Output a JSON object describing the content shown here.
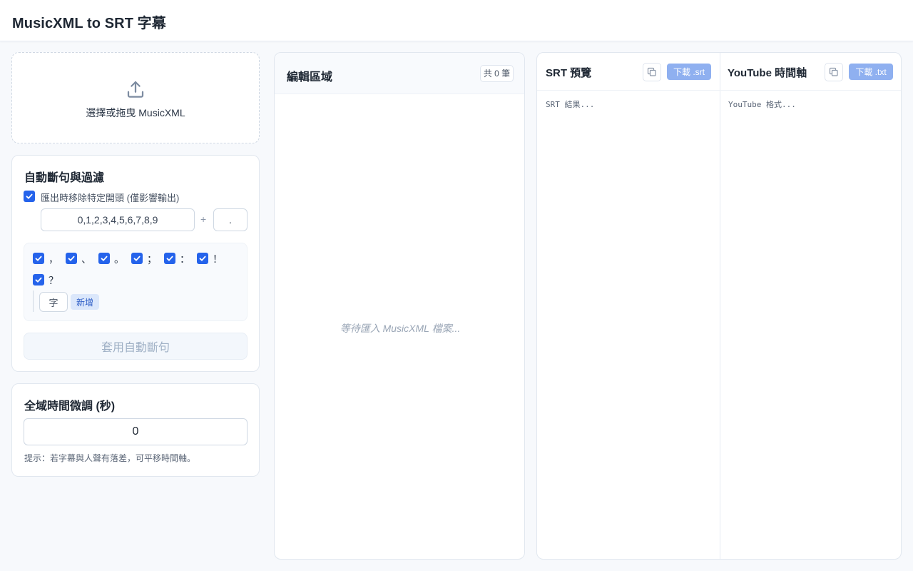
{
  "app": {
    "title": "MusicXML to SRT 字幕"
  },
  "upload": {
    "label": "選擇或拖曳 MusicXML"
  },
  "auto_split": {
    "title": "自動斷句與過濾",
    "strip_label": "匯出時移除特定開頭 (僅影響輸出)",
    "strip_chars_value": "0,1,2,3,4,5,6,7,8,9",
    "strip_extra_value": ".",
    "plus": "+",
    "punctuation": [
      {
        "char": "，",
        "checked": true
      },
      {
        "char": "、",
        "checked": true
      },
      {
        "char": "。",
        "checked": true
      },
      {
        "char": "；",
        "checked": true
      },
      {
        "char": "：",
        "checked": true
      },
      {
        "char": "！",
        "checked": true
      },
      {
        "char": "？",
        "checked": true
      }
    ],
    "custom_char_value": "字",
    "add_label": "新增",
    "apply_label": "套用自動斷句"
  },
  "offset": {
    "title": "全域時間微調 (秒)",
    "value": "0",
    "hint": "提示：若字幕與人聲有落差，可平移時間軸。"
  },
  "editor": {
    "title": "編輯區域",
    "count_label": "共 0 筆",
    "empty_text": "等待匯入 MusicXML 檔案..."
  },
  "srt": {
    "title": "SRT 預覽",
    "download_label": "下載 .srt",
    "placeholder": "SRT 結果..."
  },
  "youtube": {
    "title": "YouTube 時間軸",
    "download_label": "下載 .txt",
    "placeholder": "YouTube 格式..."
  },
  "colors": {
    "accent": "#2563eb",
    "download_button": "#8fb0f0",
    "add_button_bg": "#dbe7fb"
  },
  "icons": {
    "upload": "upload-icon",
    "copy": "copy-icon",
    "check": "checkmark-icon"
  }
}
